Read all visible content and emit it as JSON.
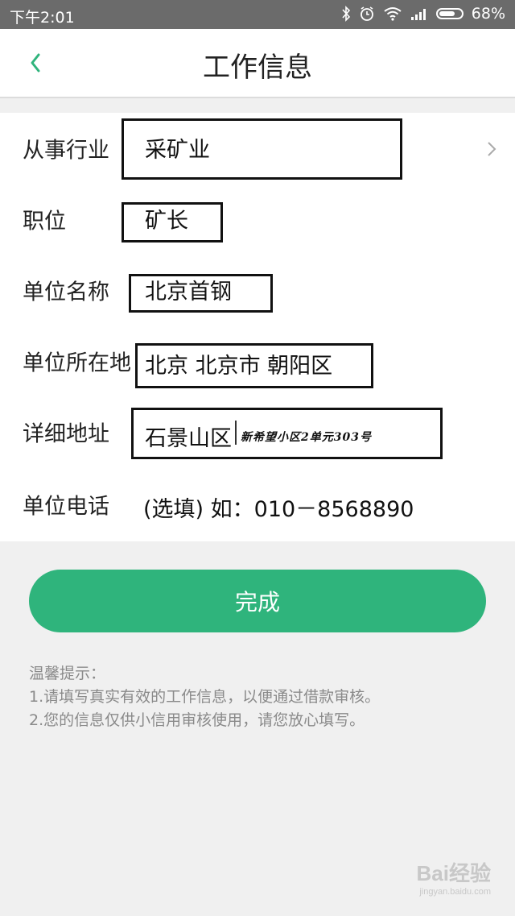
{
  "status_bar": {
    "time": "下午2:01",
    "battery": "68%"
  },
  "header": {
    "title": "工作信息"
  },
  "form": {
    "industry": {
      "label": "从事行业",
      "value": "采矿业"
    },
    "position": {
      "label": "职位",
      "value": "矿长"
    },
    "company_name": {
      "label": "单位名称",
      "value": "北京首钢"
    },
    "company_location": {
      "label": "单位所在地",
      "value": "北京 北京市 朝阳区"
    },
    "address": {
      "label": "详细地址",
      "value": "石景山区",
      "handwritten": "新希望小区2单元303号"
    },
    "phone": {
      "label": "单位电话",
      "placeholder": "(选填) 如：010－8568890"
    }
  },
  "done_button": {
    "label": "完成"
  },
  "tips": {
    "title": "温馨提示：",
    "line1": "1.请填写真实有效的工作信息，以便通过借款审核。",
    "line2": "2.您的信息仅供小信用审核使用，请您放心填写。"
  },
  "watermark": {
    "text": "Bai经验",
    "sub": "jingyan.baidu.com"
  },
  "colors": {
    "accent": "#2fb47c",
    "status_bar": "#6b6b6b"
  }
}
